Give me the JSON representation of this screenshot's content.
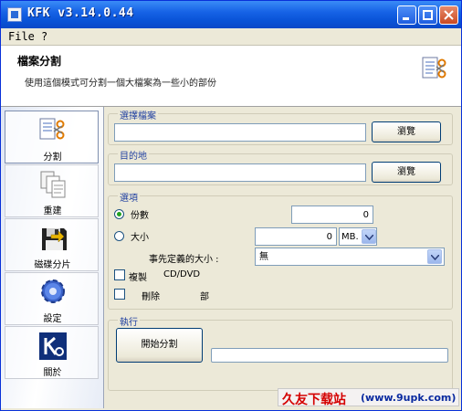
{
  "window": {
    "title": "KFK v3.14.0.44"
  },
  "menu": {
    "file": "File",
    "help": "?"
  },
  "header": {
    "title": "檔案分割",
    "description": "使用這個模式可分割一個大檔案為一些小的部份"
  },
  "sidebar": {
    "items": [
      {
        "label": "分割",
        "icon": "split-scissors-icon"
      },
      {
        "label": "重建",
        "icon": "documents-icon"
      },
      {
        "label": "磁碟分片",
        "icon": "disk-icon"
      },
      {
        "label": "設定",
        "icon": "gear-icon"
      },
      {
        "label": "關於",
        "icon": "kfk-logo-icon"
      }
    ]
  },
  "source_group": {
    "title": "選擇檔案",
    "browse": "瀏覽"
  },
  "dest_group": {
    "title": "目的地",
    "browse": "瀏覽"
  },
  "options_group": {
    "title": "選項",
    "option1_label": "份數",
    "option1_value": "0",
    "option2_label": "大小",
    "option2_value": "0",
    "option2_unit": "MB.",
    "predefined_label": "事先定義的大小 :",
    "predefined_value": "無",
    "check1_label": "複製",
    "check1_suffix": "CD/DVD",
    "check2_label": "刪除",
    "check2_suffix": "部"
  },
  "action_group": {
    "title": "執行",
    "split_button": "開始分割"
  },
  "watermark": {
    "cn": "久友下载站",
    "url": "(www.9upk.com)"
  },
  "colors": {
    "accent": "#0a54d8",
    "group_title": "#1f3fa0",
    "watermark_red": "#d40000"
  }
}
